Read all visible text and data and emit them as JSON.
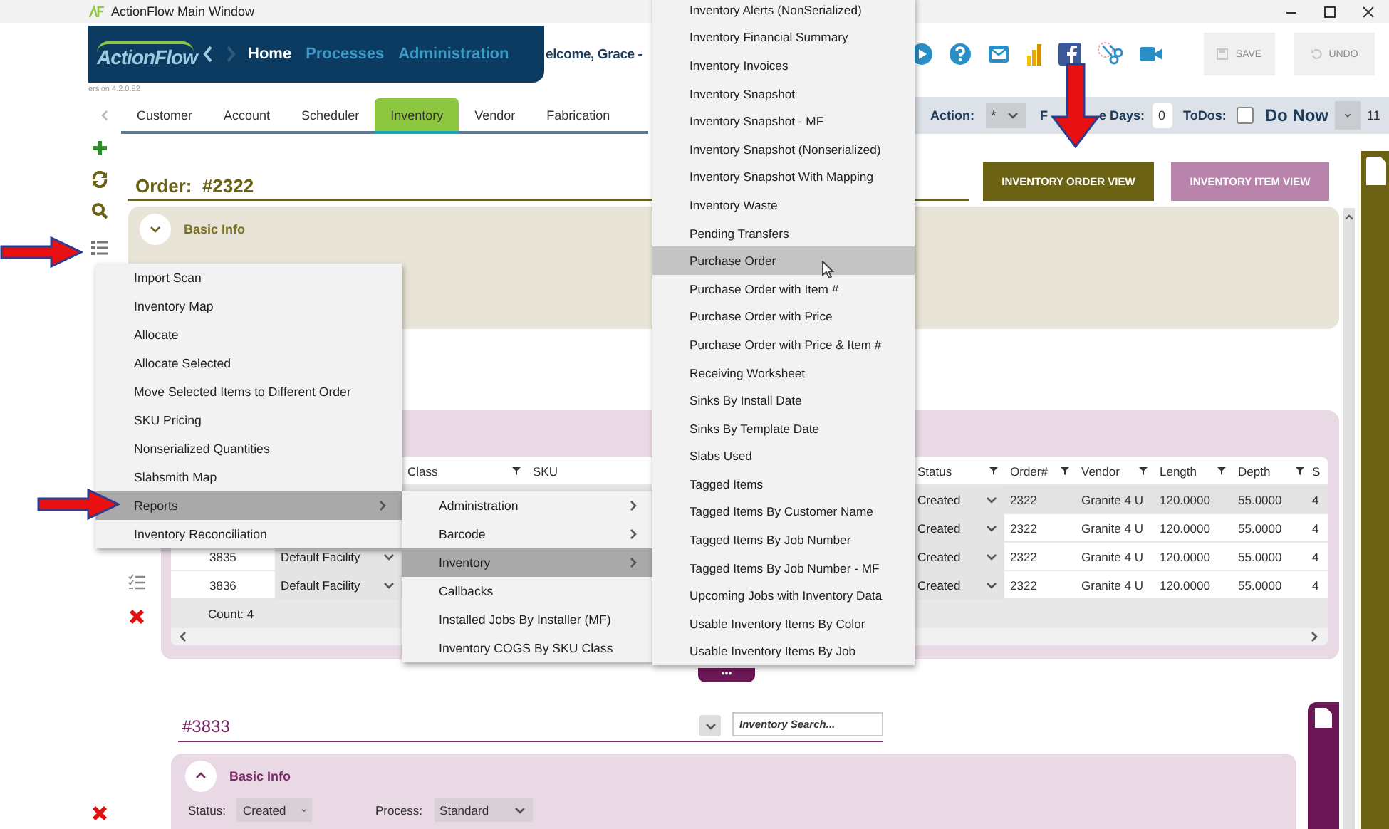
{
  "window": {
    "title": "ActionFlow Main Window"
  },
  "header": {
    "logo": "ActionFlow",
    "nav": [
      {
        "label": "Home",
        "selected": true
      },
      {
        "label": "Processes",
        "selected": false
      },
      {
        "label": "Administration",
        "selected": false
      }
    ],
    "welcome": "elcome, Grace -",
    "buttons": [
      {
        "label": "SAVE",
        "kind": "save",
        "disabled": true
      },
      {
        "label": "UNDO",
        "kind": "undo",
        "disabled": true
      }
    ]
  },
  "version": "ersion 4.2.0.82",
  "tabs": [
    {
      "label": "Customer",
      "selected": false
    },
    {
      "label": "Account",
      "selected": false
    },
    {
      "label": "Scheduler",
      "selected": false
    },
    {
      "label": "Inventory",
      "selected": true
    },
    {
      "label": "Vendor",
      "selected": false
    },
    {
      "label": "Fabrication",
      "selected": false
    }
  ],
  "toolbar": {
    "action_label": "Action:",
    "action_value": "*",
    "days_label_start": "F",
    "days_label_end": "e Days:",
    "days_value": "0",
    "todos_label": "ToDos:",
    "todos_checked": false,
    "view": "Do Now",
    "count": "11"
  },
  "order": {
    "title": "Order:  #2322",
    "view_buttons": [
      {
        "label": "INVENTORY ORDER VIEW",
        "selected": true
      },
      {
        "label": "INVENTORY ITEM VIEW",
        "selected": false
      }
    ],
    "basic_info": {
      "label": "Basic Info",
      "expanded": false
    }
  },
  "items_table": {
    "columns": [
      {
        "label": "Class",
        "filter": true
      },
      {
        "label": "SKU",
        "filter": false
      },
      {
        "label": "Status",
        "filter": true
      },
      {
        "label": "Order#",
        "filter": true
      },
      {
        "label": "Vendor",
        "filter": true
      },
      {
        "label": "Length",
        "filter": true
      },
      {
        "label": "Depth",
        "filter": true
      },
      {
        "label": "S",
        "filter": false
      }
    ],
    "rows": [
      {
        "selected": true,
        "cells": [
          "",
          "",
          "Created",
          "2322",
          "Granite 4 U",
          "120.0000",
          "55.0000",
          "4"
        ]
      },
      {
        "selected": false,
        "cells": [
          "",
          "",
          "Created",
          "2322",
          "Granite 4 U",
          "120.0000",
          "55.0000",
          "4"
        ]
      },
      {
        "selected": false,
        "id": "3835",
        "facility": "Default Facility",
        "cells": [
          "",
          "",
          "Created",
          "2322",
          "Granite 4 U",
          "120.0000",
          "55.0000",
          "4"
        ]
      },
      {
        "selected": false,
        "id": "3836",
        "facility": "Default Facility",
        "cells": [
          "",
          "",
          "Created",
          "2322",
          "Granite 4 U",
          "120.0000",
          "55.0000",
          "4"
        ]
      }
    ],
    "count": "Count: 4"
  },
  "more_button": "•••",
  "order2": {
    "title": "#3833",
    "search_placeholder": "Inventory Search...",
    "basic_info": {
      "label": "Basic Info",
      "expanded": true
    },
    "fields": [
      {
        "label": "Status:",
        "value": "Created"
      },
      {
        "label": "Process:",
        "value": "Standard"
      }
    ]
  },
  "menus": [
    {
      "items": [
        {
          "label": "Import Scan",
          "selected": false,
          "submenu": false
        },
        {
          "label": "Inventory Map",
          "selected": false,
          "submenu": false
        },
        {
          "label": "Allocate",
          "selected": false,
          "submenu": false
        },
        {
          "label": "Allocate Selected",
          "selected": false,
          "submenu": false
        },
        {
          "label": "Move Selected Items to Different Order",
          "selected": false,
          "submenu": false
        },
        {
          "label": "SKU Pricing",
          "selected": false,
          "submenu": false
        },
        {
          "label": "Nonserialized Quantities",
          "selected": false,
          "submenu": false
        },
        {
          "label": "Slabsmith Map",
          "selected": false,
          "submenu": false
        },
        {
          "label": "Reports",
          "selected": true,
          "submenu": true
        },
        {
          "label": "Inventory Reconciliation",
          "selected": false,
          "submenu": false
        }
      ]
    },
    {
      "items": [
        {
          "label": "Administration",
          "selected": false,
          "submenu": true
        },
        {
          "label": "Barcode",
          "selected": false,
          "submenu": true
        },
        {
          "label": "Inventory",
          "selected": true,
          "submenu": true
        },
        {
          "label": "Callbacks",
          "selected": false,
          "submenu": false
        },
        {
          "label": "Installed Jobs By Installer (MF)",
          "selected": false,
          "submenu": false
        },
        {
          "label": "Inventory COGS By SKU Class",
          "selected": false,
          "submenu": false
        }
      ]
    },
    {
      "items": [
        {
          "label": "Inventory Alerts (NonSerialized)",
          "selected": false,
          "submenu": false
        },
        {
          "label": "Inventory Financial Summary",
          "selected": false,
          "submenu": false
        },
        {
          "label": "Inventory Invoices",
          "selected": false,
          "submenu": false
        },
        {
          "label": "Inventory Snapshot",
          "selected": false,
          "submenu": false
        },
        {
          "label": "Inventory Snapshot - MF",
          "selected": false,
          "submenu": false
        },
        {
          "label": "Inventory Snapshot (Nonserialized)",
          "selected": false,
          "submenu": false
        },
        {
          "label": "Inventory Snapshot With Mapping",
          "selected": false,
          "submenu": false
        },
        {
          "label": "Inventory Waste",
          "selected": false,
          "submenu": false
        },
        {
          "label": "Pending Transfers",
          "selected": false,
          "submenu": false
        },
        {
          "label": "Purchase Order",
          "selected": true,
          "submenu": false
        },
        {
          "label": "Purchase Order with Item #",
          "selected": false,
          "submenu": false
        },
        {
          "label": "Purchase Order with Price",
          "selected": false,
          "submenu": false
        },
        {
          "label": "Purchase Order with Price & Item #",
          "selected": false,
          "submenu": false
        },
        {
          "label": "Receiving Worksheet",
          "selected": false,
          "submenu": false
        },
        {
          "label": "Sinks By Install Date",
          "selected": false,
          "submenu": false
        },
        {
          "label": "Sinks By Template Date",
          "selected": false,
          "submenu": false
        },
        {
          "label": "Slabs Used",
          "selected": false,
          "submenu": false
        },
        {
          "label": "Tagged Items",
          "selected": false,
          "submenu": false
        },
        {
          "label": "Tagged Items By Customer Name",
          "selected": false,
          "submenu": false
        },
        {
          "label": "Tagged Items By Job Number",
          "selected": false,
          "submenu": false
        },
        {
          "label": "Tagged Items By Job Number - MF",
          "selected": false,
          "submenu": false
        },
        {
          "label": "Upcoming Jobs with Inventory Data",
          "selected": false,
          "submenu": false
        },
        {
          "label": "Usable Inventory Items By Color",
          "selected": false,
          "submenu": false
        },
        {
          "label": "Usable Inventory Items By Job",
          "selected": false,
          "submenu": false
        }
      ]
    }
  ]
}
